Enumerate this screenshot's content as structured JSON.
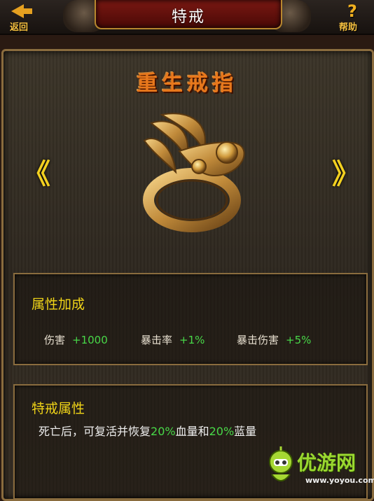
{
  "header": {
    "title": "特戒",
    "back_label": "返回",
    "help_label": "帮助",
    "help_symbol": "?"
  },
  "ring": {
    "name": "重生戒指",
    "prev_arrow": "《",
    "next_arrow": "》"
  },
  "attributes": {
    "title": "属性加成",
    "stats": [
      {
        "label": "伤害",
        "value": "+1000"
      },
      {
        "label": "暴击率",
        "value": "+1%"
      },
      {
        "label": "暴击伤害",
        "value": "+5%"
      }
    ]
  },
  "special": {
    "title": "特戒属性",
    "desc_parts": [
      "死亡后，可复活并恢复",
      "20%",
      "血量和",
      "20%",
      "蓝量"
    ]
  },
  "watermark": {
    "text": "优游网",
    "url": "www.yoyou.com"
  },
  "colors": {
    "accent_gold": "#f0d418",
    "value_green": "#48d848",
    "title_orange": "#e8781c"
  }
}
